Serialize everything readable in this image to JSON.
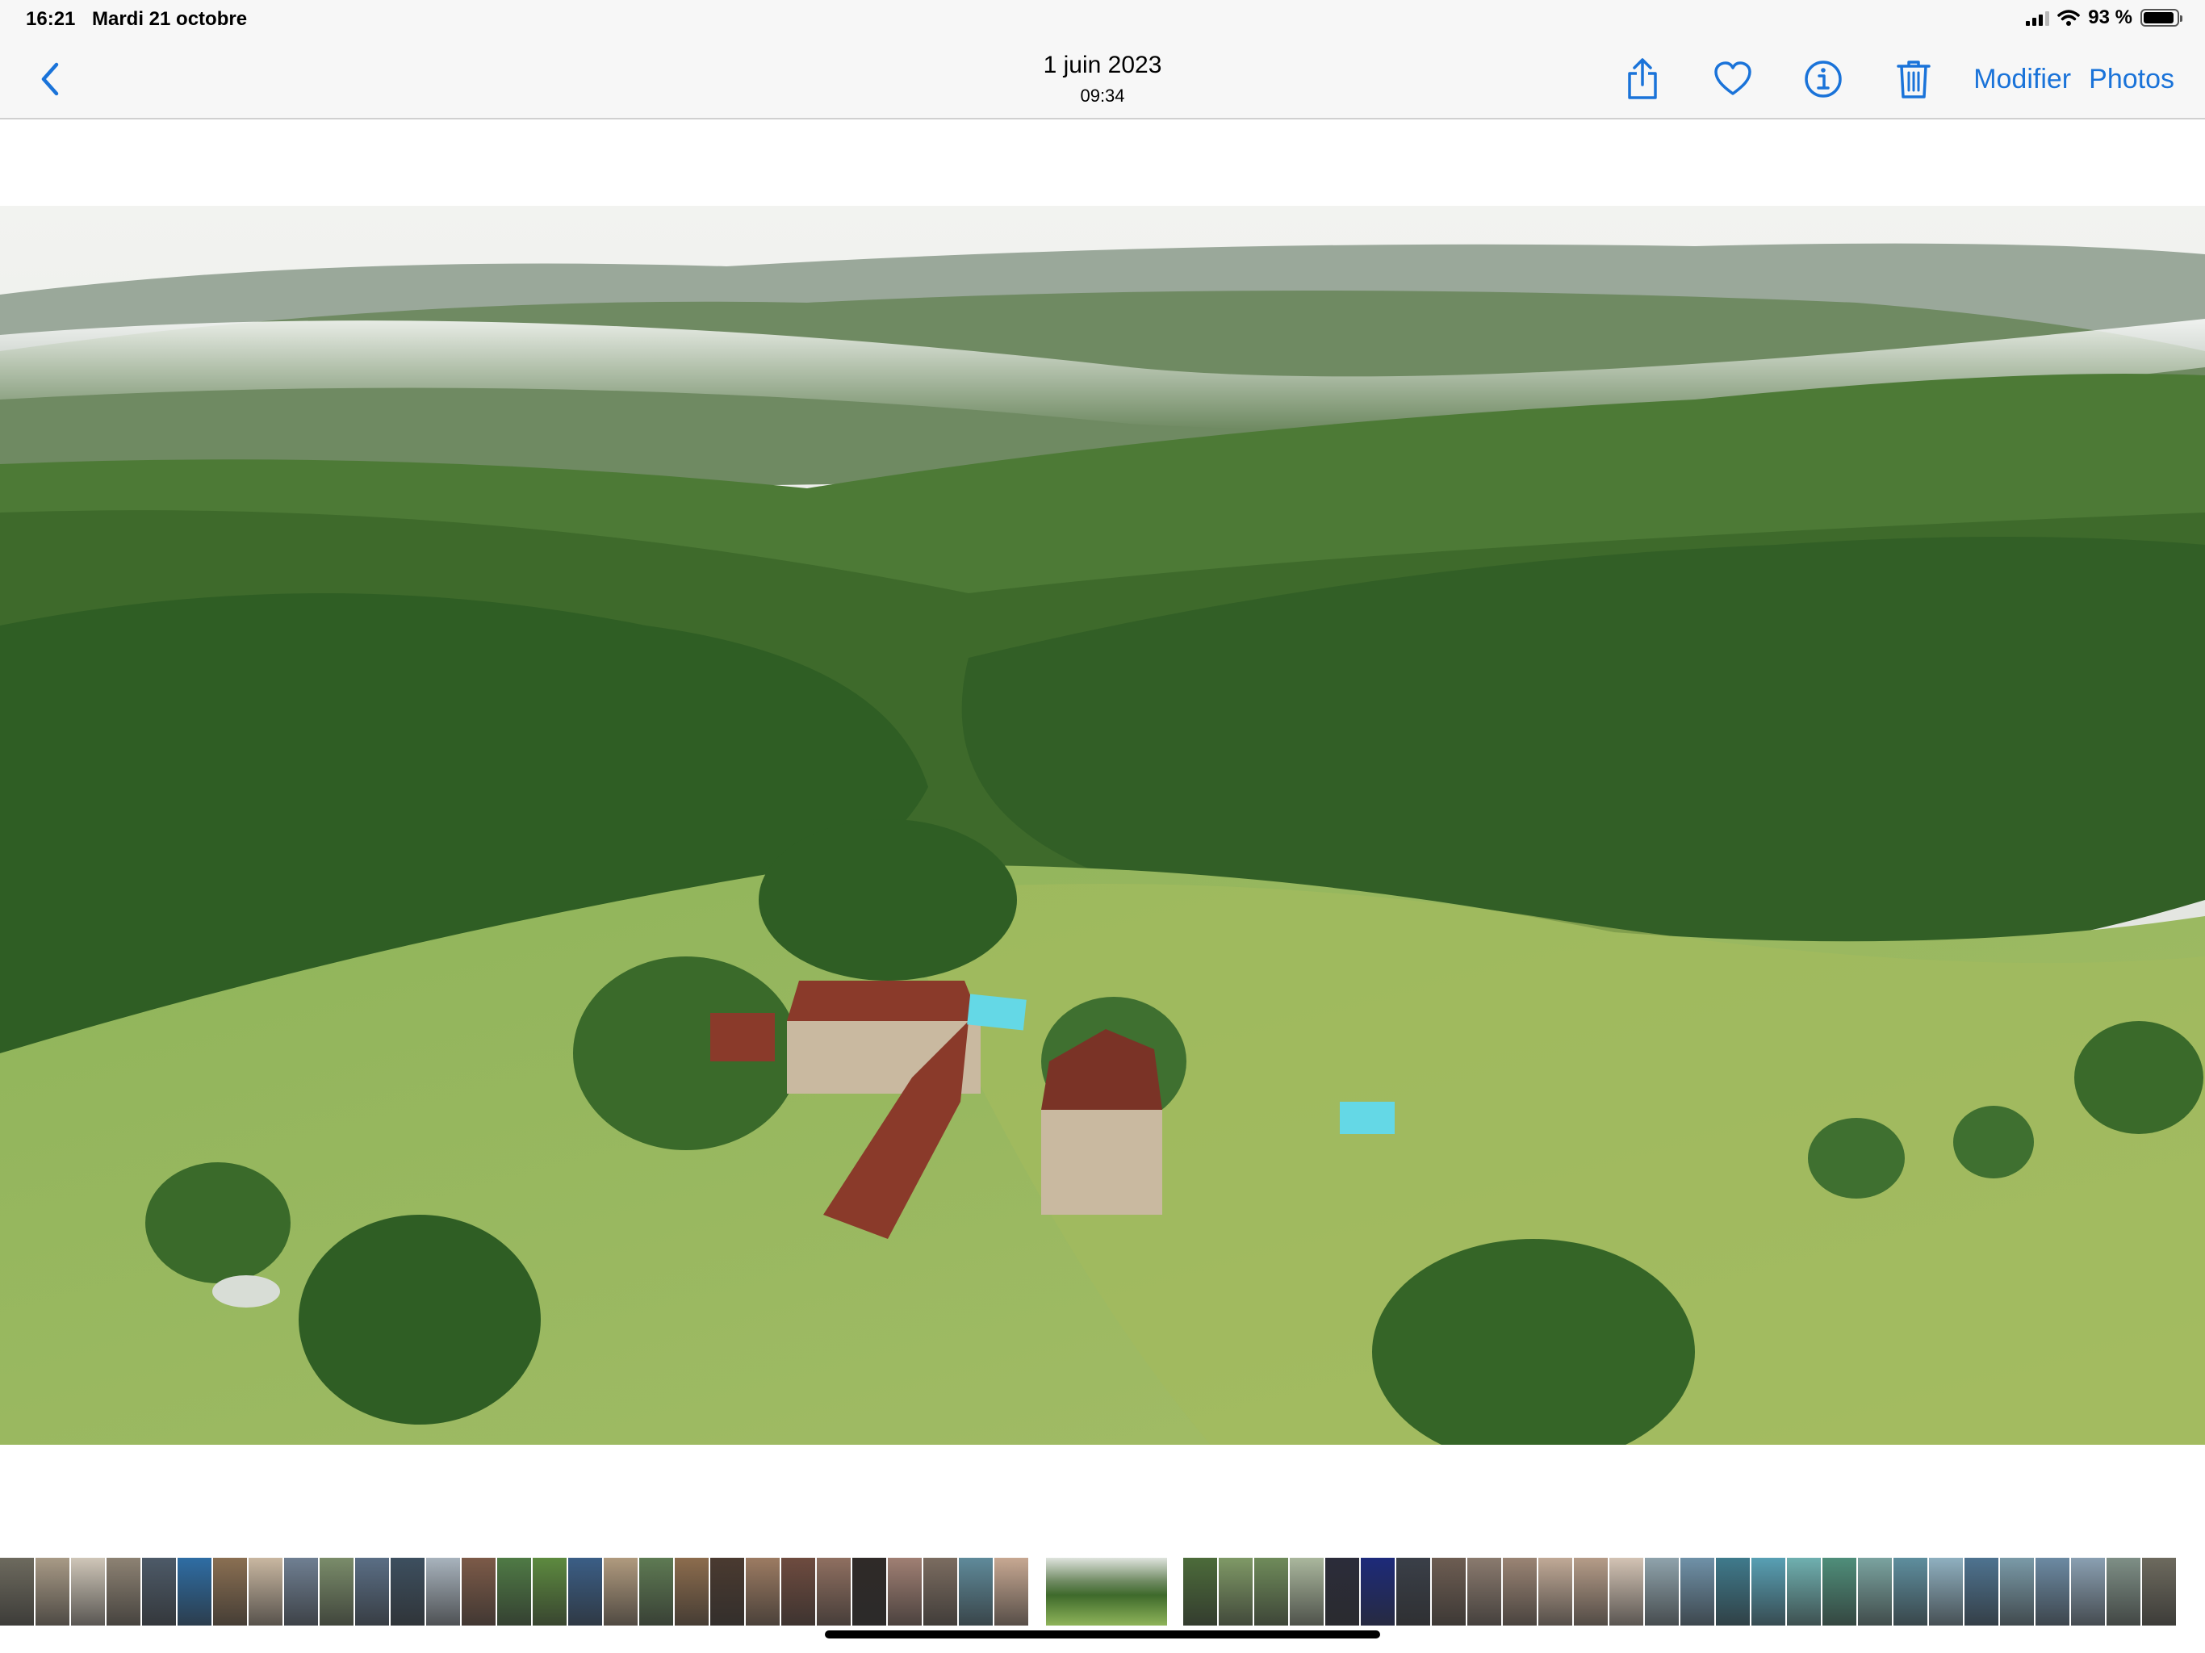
{
  "status_bar": {
    "time": "16:21",
    "date": "Mardi 21 octobre",
    "battery_text": "93 %",
    "battery_level": 0.93
  },
  "nav": {
    "title": "1 juin 2023",
    "subtitle": "09:34",
    "edit_label": "Modifier",
    "photos_label": "Photos",
    "accent_color": "#1a73d9",
    "icons": [
      "chevron-left-icon",
      "share-icon",
      "heart-icon",
      "info-icon",
      "trash-icon"
    ]
  },
  "photo": {
    "subject": "aerial-countryside-farmhouse",
    "colors": {
      "sky": "#e9ecea",
      "forest": "#3e6a2b",
      "meadow": "#8fb25a",
      "roof": "#8a3a2a",
      "pool": "#64d8e6"
    }
  },
  "thumbnails": {
    "count_before": 29,
    "count_after": 28,
    "colors": [
      "#6d6a5e",
      "#a89a86",
      "#cfc6b8",
      "#8d8273",
      "#4d5a68",
      "#2e6da4",
      "#8a6f52",
      "#c9b7a1",
      "#6f7f92",
      "#7a8c6a",
      "#5a6e85",
      "#3d4f5f",
      "#a8b3bd",
      "#7c5a48",
      "#4f7a45",
      "#5d8a3f",
      "#3b5e86",
      "#b09a7e",
      "#5e7a53",
      "#8c6c4d",
      "#4a3a30",
      "#9c7b62",
      "#6e4b3f",
      "#8f6f60",
      "#2f2a28",
      "#a07f73",
      "#7b6c60",
      "#5f8a9a",
      "#c7a892",
      "#6a8753",
      "#4c6b3a",
      "#7f9966",
      "#6f8b5a",
      "#aab79d",
      "#2b2c3a",
      "#1d2a7a",
      "#3a3f48",
      "#6d5d52",
      "#8a7a6e",
      "#9a8474",
      "#c0a996",
      "#b59c88",
      "#d3c3b4",
      "#8fa3ac",
      "#6f91a8",
      "#3f7a8c",
      "#58a0b4",
      "#6fb0b0",
      "#4f8e7a",
      "#7aa3a0",
      "#5e8e9e",
      "#8fb0c0",
      "#4e7390",
      "#7a9aa8",
      "#6c8aa3",
      "#8aa0b2",
      "#7e8f86"
    ]
  }
}
